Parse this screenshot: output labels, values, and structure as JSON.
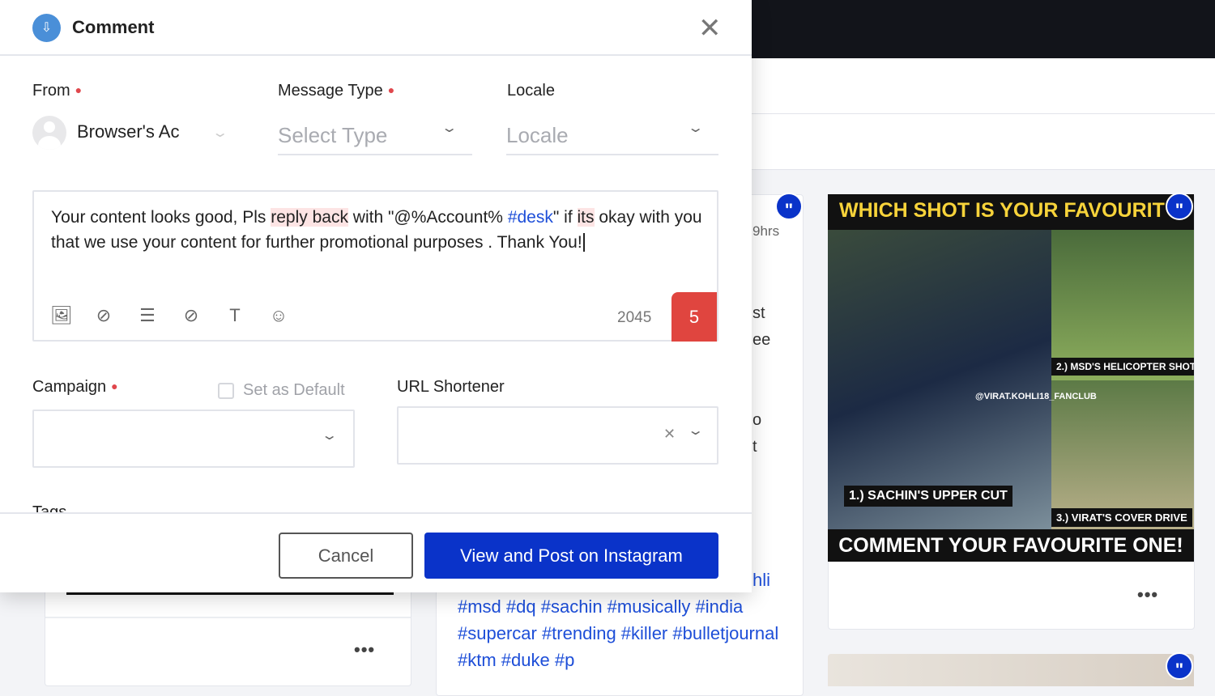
{
  "modal": {
    "title": "Comment",
    "from": {
      "label": "From",
      "value": "Browser's Ac"
    },
    "message_type": {
      "label": "Message Type",
      "placeholder": "Select Type"
    },
    "locale": {
      "label": "Locale",
      "placeholder": "Locale"
    },
    "editor": {
      "segments": [
        "Your content looks good, Pls ",
        "reply back",
        " with \"@%Account% ",
        "#desk",
        "\" if ",
        "its",
        " okay with you that we use your content for further promotional purposes . Thank You!"
      ],
      "char_count": "2045",
      "issue_badge": "5"
    },
    "campaign": {
      "label": "Campaign",
      "set_default": "Set as Default"
    },
    "url_shortener": {
      "label": "URL Shortener"
    },
    "tags_label": "Tags",
    "cancel": "Cancel",
    "post": "View and Post on Instagram"
  },
  "background": {
    "post_time": "9hrs",
    "partial_text": [
      "st",
      "ee",
      "o",
      "t"
    ],
    "hashtags_partial": "hli",
    "hashtags": "#msd #dq #sachin #musically #india #supercar #trending #killer #bulletjournal #ktm #duke #p",
    "poster": {
      "title": "WHICH SHOT IS YOUR FAVOURIT",
      "label1": "1.) SACHIN'S UPPER CUT",
      "label2": "2.) MSD'S HELICOPTER SHOT",
      "label3": "3.) VIRAT'S COVER DRIVE",
      "handle": "@VIRAT.KOHLI18_FANCLUB",
      "bottom": "COMMENT YOUR FAVOURITE ONE!"
    }
  },
  "colors": {
    "primary": "#0a33c9",
    "required": "#e0474c",
    "hashtag": "#1d4ed8"
  }
}
